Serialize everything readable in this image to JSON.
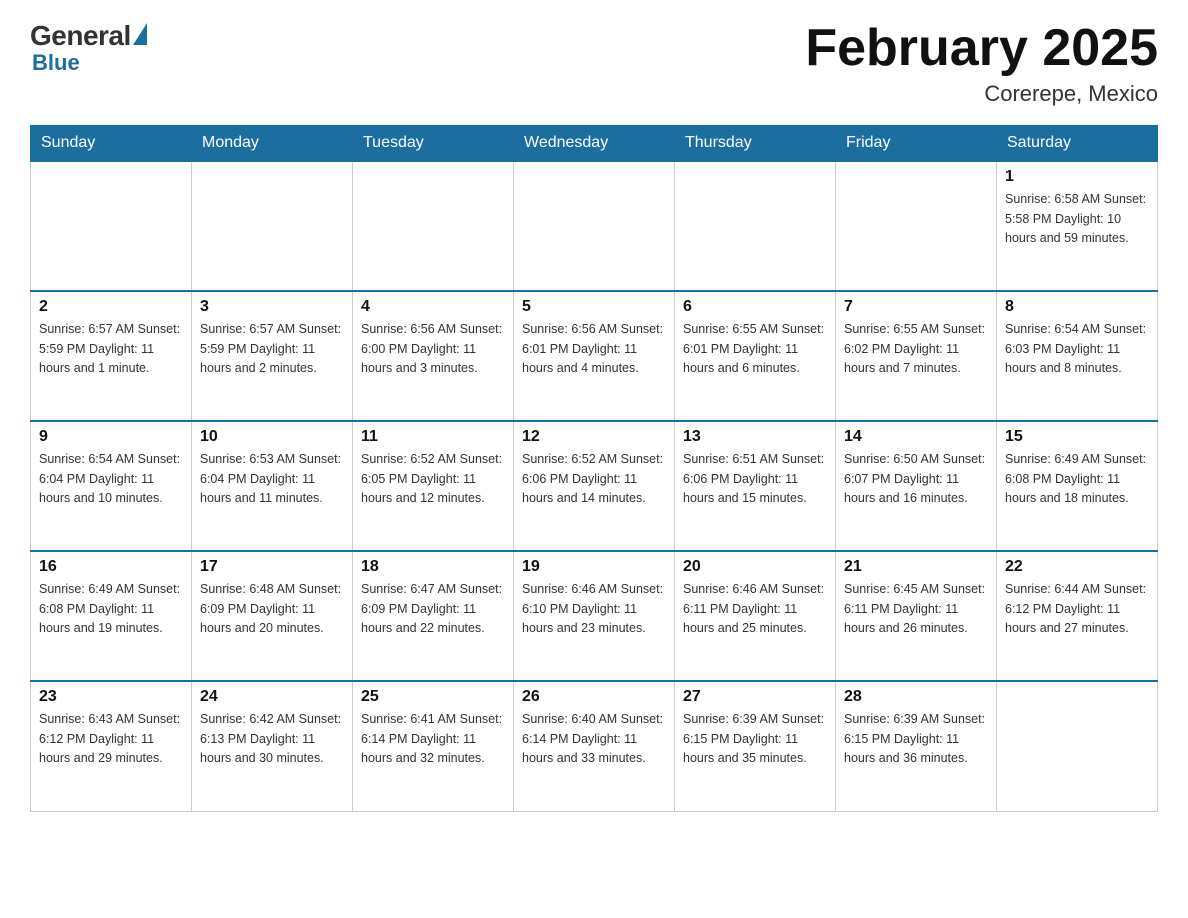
{
  "header": {
    "logo_general": "General",
    "logo_blue": "Blue",
    "month_title": "February 2025",
    "location": "Corerepe, Mexico"
  },
  "days_of_week": [
    "Sunday",
    "Monday",
    "Tuesday",
    "Wednesday",
    "Thursday",
    "Friday",
    "Saturday"
  ],
  "weeks": [
    [
      {
        "day": "",
        "info": ""
      },
      {
        "day": "",
        "info": ""
      },
      {
        "day": "",
        "info": ""
      },
      {
        "day": "",
        "info": ""
      },
      {
        "day": "",
        "info": ""
      },
      {
        "day": "",
        "info": ""
      },
      {
        "day": "1",
        "info": "Sunrise: 6:58 AM\nSunset: 5:58 PM\nDaylight: 10 hours\nand 59 minutes."
      }
    ],
    [
      {
        "day": "2",
        "info": "Sunrise: 6:57 AM\nSunset: 5:59 PM\nDaylight: 11 hours\nand 1 minute."
      },
      {
        "day": "3",
        "info": "Sunrise: 6:57 AM\nSunset: 5:59 PM\nDaylight: 11 hours\nand 2 minutes."
      },
      {
        "day": "4",
        "info": "Sunrise: 6:56 AM\nSunset: 6:00 PM\nDaylight: 11 hours\nand 3 minutes."
      },
      {
        "day": "5",
        "info": "Sunrise: 6:56 AM\nSunset: 6:01 PM\nDaylight: 11 hours\nand 4 minutes."
      },
      {
        "day": "6",
        "info": "Sunrise: 6:55 AM\nSunset: 6:01 PM\nDaylight: 11 hours\nand 6 minutes."
      },
      {
        "day": "7",
        "info": "Sunrise: 6:55 AM\nSunset: 6:02 PM\nDaylight: 11 hours\nand 7 minutes."
      },
      {
        "day": "8",
        "info": "Sunrise: 6:54 AM\nSunset: 6:03 PM\nDaylight: 11 hours\nand 8 minutes."
      }
    ],
    [
      {
        "day": "9",
        "info": "Sunrise: 6:54 AM\nSunset: 6:04 PM\nDaylight: 11 hours\nand 10 minutes."
      },
      {
        "day": "10",
        "info": "Sunrise: 6:53 AM\nSunset: 6:04 PM\nDaylight: 11 hours\nand 11 minutes."
      },
      {
        "day": "11",
        "info": "Sunrise: 6:52 AM\nSunset: 6:05 PM\nDaylight: 11 hours\nand 12 minutes."
      },
      {
        "day": "12",
        "info": "Sunrise: 6:52 AM\nSunset: 6:06 PM\nDaylight: 11 hours\nand 14 minutes."
      },
      {
        "day": "13",
        "info": "Sunrise: 6:51 AM\nSunset: 6:06 PM\nDaylight: 11 hours\nand 15 minutes."
      },
      {
        "day": "14",
        "info": "Sunrise: 6:50 AM\nSunset: 6:07 PM\nDaylight: 11 hours\nand 16 minutes."
      },
      {
        "day": "15",
        "info": "Sunrise: 6:49 AM\nSunset: 6:08 PM\nDaylight: 11 hours\nand 18 minutes."
      }
    ],
    [
      {
        "day": "16",
        "info": "Sunrise: 6:49 AM\nSunset: 6:08 PM\nDaylight: 11 hours\nand 19 minutes."
      },
      {
        "day": "17",
        "info": "Sunrise: 6:48 AM\nSunset: 6:09 PM\nDaylight: 11 hours\nand 20 minutes."
      },
      {
        "day": "18",
        "info": "Sunrise: 6:47 AM\nSunset: 6:09 PM\nDaylight: 11 hours\nand 22 minutes."
      },
      {
        "day": "19",
        "info": "Sunrise: 6:46 AM\nSunset: 6:10 PM\nDaylight: 11 hours\nand 23 minutes."
      },
      {
        "day": "20",
        "info": "Sunrise: 6:46 AM\nSunset: 6:11 PM\nDaylight: 11 hours\nand 25 minutes."
      },
      {
        "day": "21",
        "info": "Sunrise: 6:45 AM\nSunset: 6:11 PM\nDaylight: 11 hours\nand 26 minutes."
      },
      {
        "day": "22",
        "info": "Sunrise: 6:44 AM\nSunset: 6:12 PM\nDaylight: 11 hours\nand 27 minutes."
      }
    ],
    [
      {
        "day": "23",
        "info": "Sunrise: 6:43 AM\nSunset: 6:12 PM\nDaylight: 11 hours\nand 29 minutes."
      },
      {
        "day": "24",
        "info": "Sunrise: 6:42 AM\nSunset: 6:13 PM\nDaylight: 11 hours\nand 30 minutes."
      },
      {
        "day": "25",
        "info": "Sunrise: 6:41 AM\nSunset: 6:14 PM\nDaylight: 11 hours\nand 32 minutes."
      },
      {
        "day": "26",
        "info": "Sunrise: 6:40 AM\nSunset: 6:14 PM\nDaylight: 11 hours\nand 33 minutes."
      },
      {
        "day": "27",
        "info": "Sunrise: 6:39 AM\nSunset: 6:15 PM\nDaylight: 11 hours\nand 35 minutes."
      },
      {
        "day": "28",
        "info": "Sunrise: 6:39 AM\nSunset: 6:15 PM\nDaylight: 11 hours\nand 36 minutes."
      },
      {
        "day": "",
        "info": ""
      }
    ]
  ]
}
